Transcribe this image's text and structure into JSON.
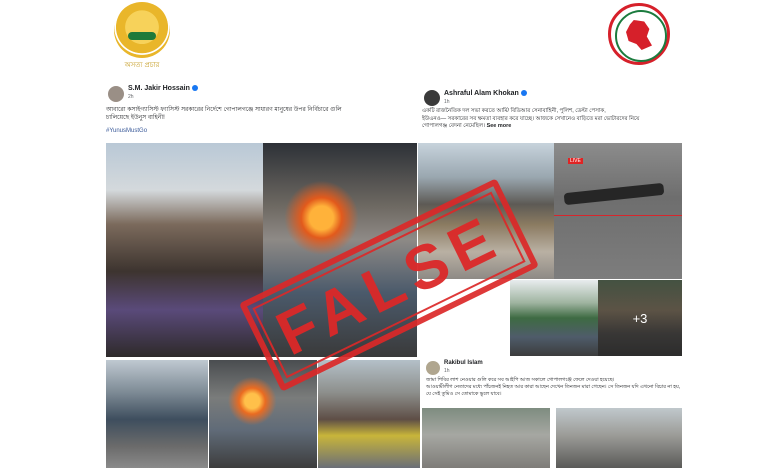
{
  "logos": {
    "left_caption": "অসত্য প্রচার",
    "left_icon": "gold-emblem-icon",
    "right_icon": "bangladesh-government-seal-icon"
  },
  "post_left": {
    "author": "S.M. Jakir Hossain",
    "time": "2h",
    "text_line1": "আবারো কসাইগ্যাসিস্ট ফ্যাসিস্ট সরকারের নির্দেশে গোপালগঞ্জে সাধারণ মানুষের উপর নির্বিচারে গুলি",
    "text_line2": "চালিয়েছে ইউনুস বাহিনী!",
    "hashtag": "#YunusMustGo"
  },
  "post_right": {
    "author": "Ashraful Alam Khokan",
    "time": "1h",
    "text_line1": "একটি রাজনৈতিক দল সভা করতে আর্মি/ বিডিআর সেনাবাহিনী, পুলিশ, ডেল্টা পেসাক,",
    "text_line2": "ইউএনও— সরকারের সব ক্ষমতা ব্যবহার করে যাচ্ছে। আজকে সেখানেও বাড়িতে মরা ভোটারদের নিয়ে",
    "text_line3": "গোপালগঞ্জ বেদনা নেমেছিল।",
    "see_more": "See more"
  },
  "photos": {
    "live_badge": "LIVE",
    "more_count": "+3"
  },
  "post_bottom": {
    "author": "Rakibul Islam",
    "time": "1h",
    "text_line1": "জামা শিবির লাশ নেওয়ার গুলি করে সব আইপি আজ সকালে গোপালগঞ্জে ফেলে দেওয়া হয়েছে।",
    "text_line2": "আওয়ামীলীগ নেতাদের মধ্যে পাঁচজনই নিহত আর কারা আছেন দেখেন তিনজন মারা গেছেন। সে তিনজন যদি এখনো বিচার না হয়,",
    "text_line3": "যে সেই তুমিও সে তোমাকে ভুলে যাবে।"
  },
  "stamp": {
    "label": "FALSE",
    "color": "#db2828"
  }
}
